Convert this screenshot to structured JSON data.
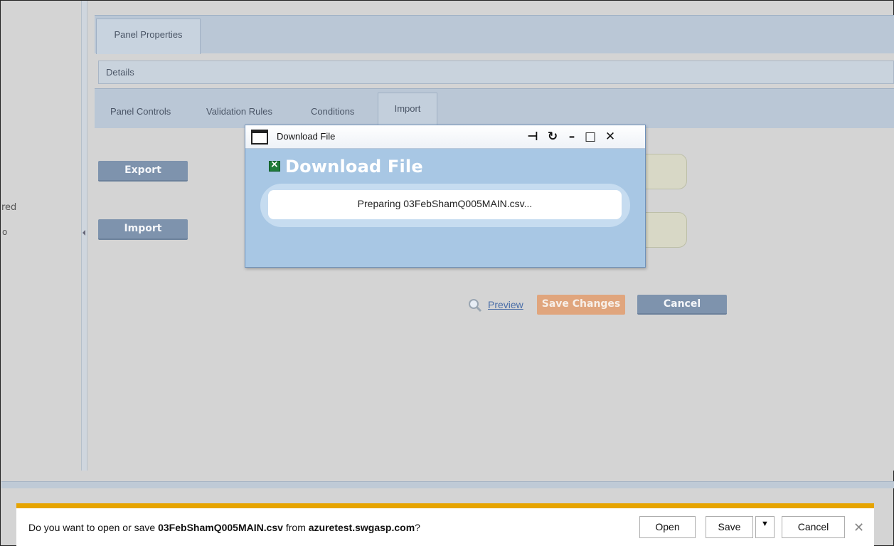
{
  "left": {
    "partial_text": "red",
    "partial_text2": "o"
  },
  "tabs": {
    "panel_properties": "Panel Properties"
  },
  "details": {
    "label": "Details"
  },
  "sub_tabs": [
    {
      "label": "Panel Controls"
    },
    {
      "label": "Validation Rules"
    },
    {
      "label": "Conditions"
    },
    {
      "label": "Import"
    }
  ],
  "buttons": {
    "export": "Export",
    "import": "Import",
    "preview": "Preview",
    "save_changes": "Save Changes",
    "cancel": "Cancel"
  },
  "modal": {
    "title": "Download File",
    "heading": "Download File",
    "status": "Preparing 03FebShamQ005MAIN.csv..."
  },
  "notification": {
    "prefix": "Do you want to open or save ",
    "filename": "03FebShamQ005MAIN.csv",
    "middle": " from ",
    "domain": "azuretest.swgasp.com",
    "suffix": "?",
    "open": "Open",
    "save": "Save",
    "cancel": "Cancel"
  },
  "colors": {
    "accent_orange": "#e6a400",
    "button_blue": "#7e93ad",
    "save_orange": "#e0a57d",
    "modal_blue": "#a8c7e4"
  }
}
